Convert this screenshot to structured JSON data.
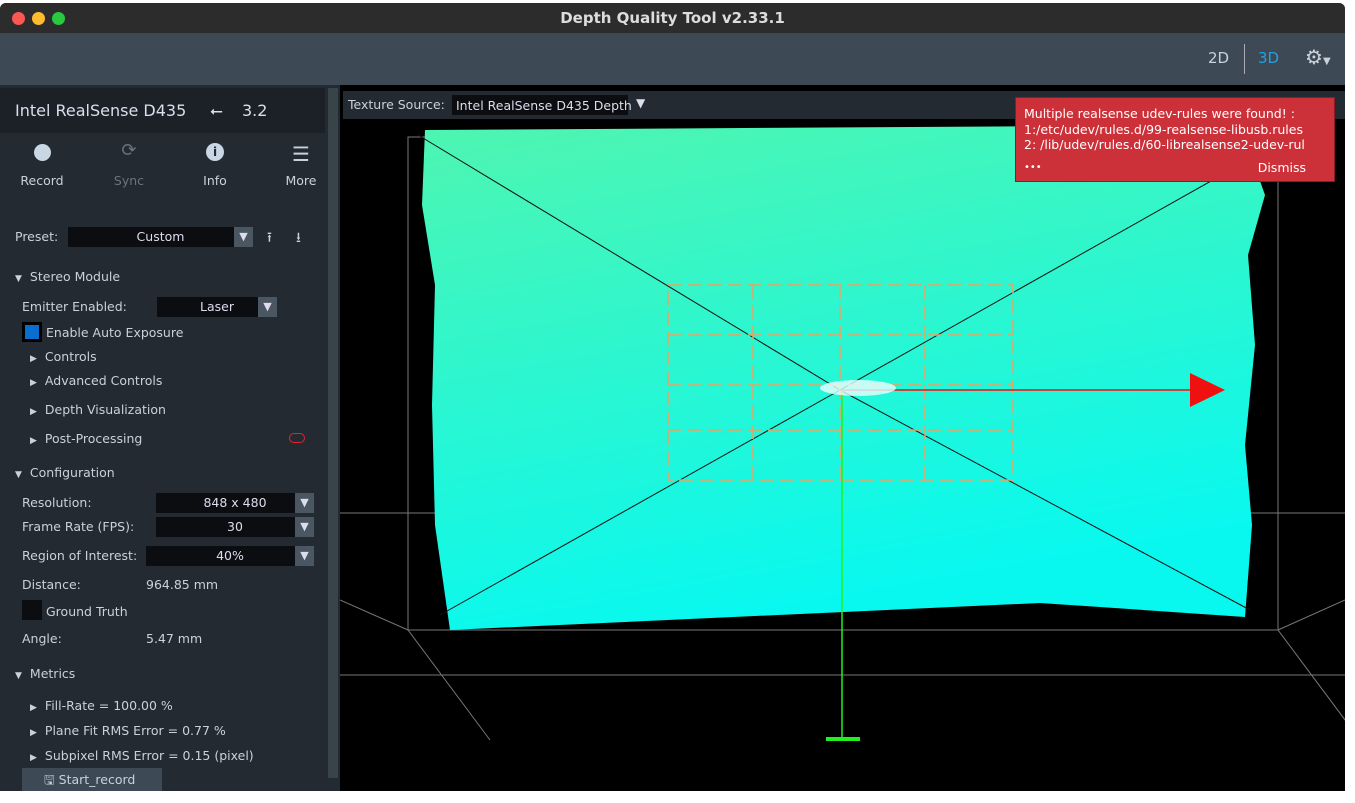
{
  "window": {
    "title": "Depth Quality Tool v2.33.1"
  },
  "toolbar": {
    "mode_2d": "2D",
    "mode_3d": "3D",
    "accent": "#1fa2e6"
  },
  "device": {
    "name": "Intel RealSense D435",
    "usb": "3.2"
  },
  "actions": [
    {
      "label": "Record",
      "icon": "record-icon"
    },
    {
      "label": "Sync",
      "icon": "sync-icon"
    },
    {
      "label": "Info",
      "icon": "info-icon"
    },
    {
      "label": "More",
      "icon": "menu-icon"
    }
  ],
  "preset": {
    "label": "Preset:",
    "value": "Custom"
  },
  "stereo": {
    "title": "Stereo Module",
    "emitter_label": "Emitter Enabled:",
    "emitter_value": "Laser",
    "auto_exposure": "Enable Auto Exposure",
    "auto_exposure_checked": true,
    "sections": [
      "Controls",
      "Advanced Controls",
      "Depth Visualization",
      "Post-Processing"
    ]
  },
  "config": {
    "title": "Configuration",
    "resolution_label": "Resolution:",
    "resolution": "848 x 480",
    "fps_label": "Frame Rate (FPS):",
    "fps": "30",
    "roi_label": "Region of Interest:",
    "roi": "40%",
    "distance_label": "Distance:",
    "distance": "964.85 mm",
    "ground_truth": "Ground Truth",
    "angle_label": "Angle:",
    "angle": "5.47 mm"
  },
  "metrics": {
    "title": "Metrics",
    "items": [
      "Fill-Rate = 100.00 %",
      "Plane Fit RMS Error = 0.77 %",
      "Subpixel RMS Error = 0.15 (pixel)"
    ],
    "record_button": "Start_record"
  },
  "viewport": {
    "texture_label": "Texture Source:",
    "texture_value": "Intel RealSense D435 Depth"
  },
  "notification": {
    "lines": [
      "Multiple realsense udev-rules were found! :",
      "1:/etc/udev/rules.d/99-realsense-libusb.rules",
      "2: /lib/udev/rules.d/60-librealsense2-udev-rul"
    ],
    "more": "•••",
    "dismiss": "Dismiss",
    "color": "#cc3038"
  }
}
